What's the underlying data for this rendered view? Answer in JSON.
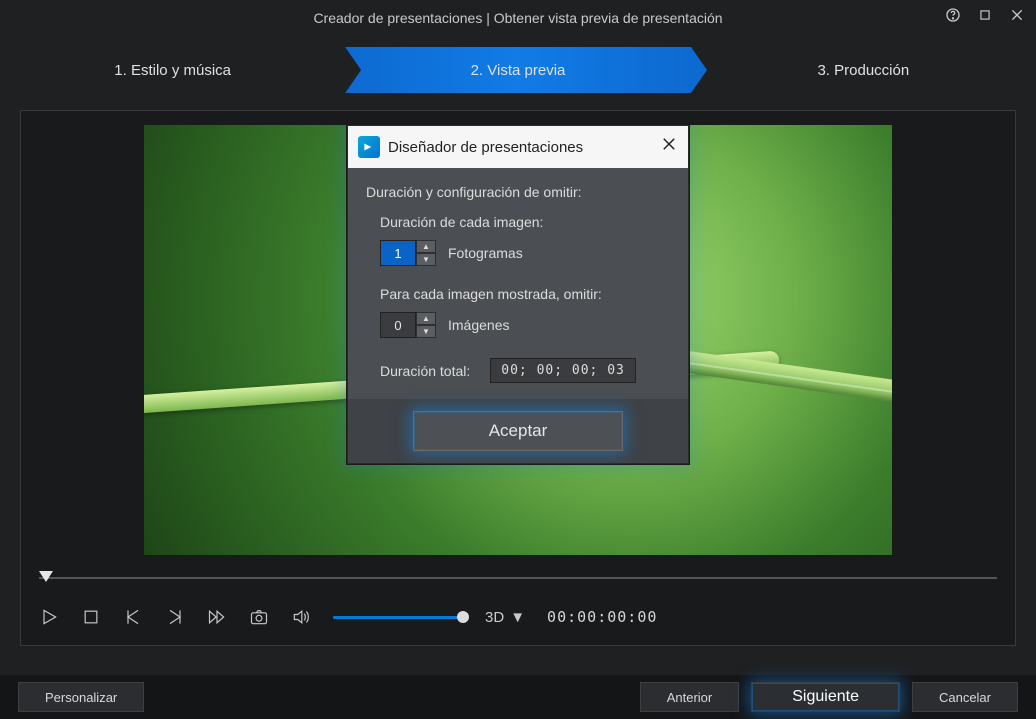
{
  "titlebar": {
    "title": "Creador de presentaciones | Obtener vista previa de presentación"
  },
  "steps": {
    "s1": "1. Estilo y música",
    "s2": "2. Vista previa",
    "s3": "3. Producción"
  },
  "modal": {
    "title": "Diseñador de presentaciones",
    "section": "Duración y configuración de omitir:",
    "duration_label": "Duración de cada imagen:",
    "duration_value": "1",
    "duration_unit": "Fotogramas",
    "skip_label": "Para cada imagen mostrada, omitir:",
    "skip_value": "0",
    "skip_unit": "Imágenes",
    "total_label": "Duración total:",
    "total_value": "00; 00; 00; 03",
    "accept": "Aceptar"
  },
  "transport": {
    "mode3d": "3D",
    "timecode": "00:00:00:00"
  },
  "bottom": {
    "customize": "Personalizar",
    "previous": "Anterior",
    "next": "Siguiente",
    "cancel": "Cancelar"
  }
}
